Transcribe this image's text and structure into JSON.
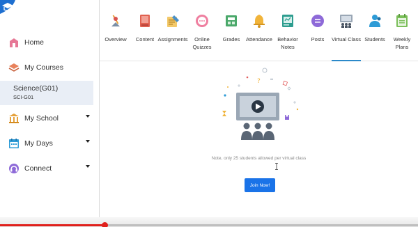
{
  "sidebar": {
    "items": [
      {
        "label": "Home",
        "icon": "home-icon"
      },
      {
        "label": "My Courses",
        "icon": "courses-icon"
      },
      {
        "label": "My School",
        "icon": "school-icon"
      },
      {
        "label": "My Days",
        "icon": "calendar-icon"
      },
      {
        "label": "Connect",
        "icon": "connect-icon"
      }
    ],
    "course": {
      "name": "Science(G01)",
      "code": "SCI-G01"
    }
  },
  "tabs": [
    {
      "label": "Overview",
      "icon": "overview-icon"
    },
    {
      "label": "Content",
      "icon": "content-icon"
    },
    {
      "label": "Assignments",
      "icon": "assignments-icon"
    },
    {
      "label": "Online\nQuizzes",
      "icon": "quizzes-icon"
    },
    {
      "label": "Grades",
      "icon": "grades-icon"
    },
    {
      "label": "Attendance",
      "icon": "attendance-icon"
    },
    {
      "label": "Behavior\nNotes",
      "icon": "behavior-notes-icon"
    },
    {
      "label": "Posts",
      "icon": "posts-icon"
    },
    {
      "label": "Virtual Class",
      "icon": "virtual-class-icon"
    },
    {
      "label": "Students",
      "icon": "students-icon"
    },
    {
      "label": "Weekly Plans",
      "icon": "weekly-plans-icon"
    }
  ],
  "active_tab": "Virtual Class",
  "main": {
    "note": "Note, only 25 students allowed per virtual class",
    "join_label": "Join Now!"
  },
  "video": {
    "progress_fraction": 0.25
  },
  "colors": {
    "accent": "#2b89c9",
    "button": "#1a73e8",
    "selected_bg": "#e9eef6",
    "progress": "#e0201c"
  }
}
